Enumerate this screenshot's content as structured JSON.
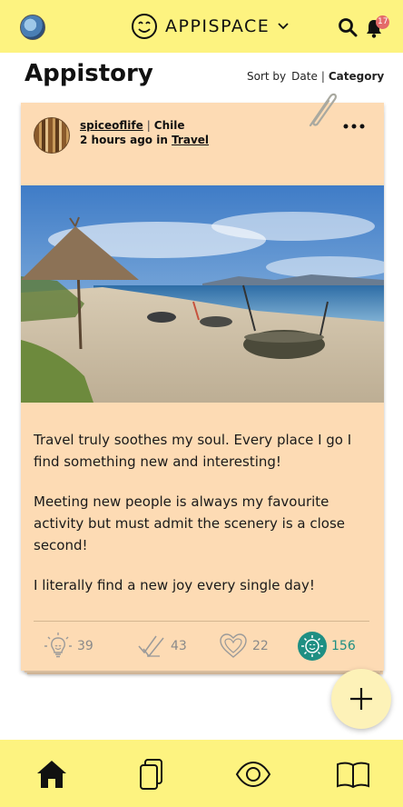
{
  "topbar": {
    "brand": "APPISPACE",
    "notification_count": "17",
    "icons": [
      "user-avatar",
      "smiley-logo-icon",
      "chevron-down-icon",
      "search-icon",
      "bell-icon"
    ]
  },
  "page": {
    "title": "Appistory",
    "sort_label": "Sort by",
    "sort_options": [
      "Date",
      "Category"
    ],
    "sort_active": "Category"
  },
  "post": {
    "author": "spiceoflife",
    "location": "Chile",
    "time": "2 hours ago in",
    "category": "Travel",
    "paragraphs": [
      "Travel truly soothes my soul.  Every place I go I find something new and interesting!",
      "Meeting new people is always my favourite activity but must admit the scenery is a close second!",
      "I literally find a new joy every single day!"
    ],
    "stats": {
      "ideas": "39",
      "checks": "43",
      "hearts": "22",
      "joy": "156"
    },
    "icons": [
      "paperclip-icon",
      "more-icon",
      "lightbulb-icon",
      "double-check-icon",
      "heart-icon",
      "joy-sun-icon"
    ]
  },
  "bottom_nav": {
    "icons": [
      "home-icon",
      "cards-icon",
      "eye-icon",
      "book-icon"
    ]
  },
  "colors": {
    "bar_yellow": "#fdf380",
    "card_peach": "#fddbb4",
    "accent_teal": "#1f8f83",
    "badge_red": "#e46a6a"
  }
}
